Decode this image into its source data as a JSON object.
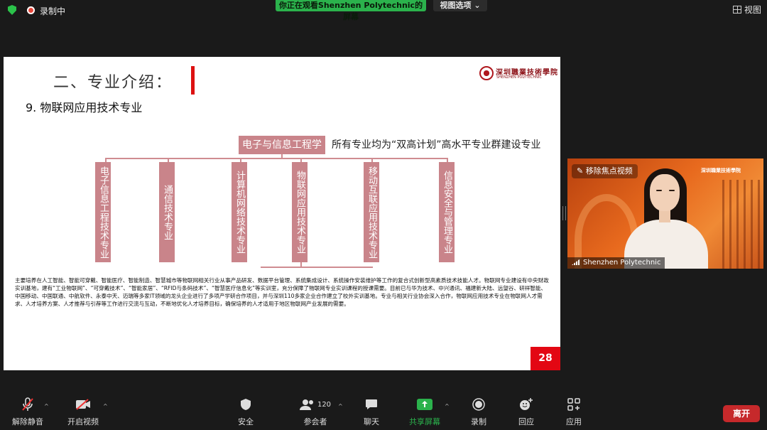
{
  "top": {
    "recording_text": "录制中",
    "share_banner": "你正在观看Shenzhen Polytechnic的屏幕",
    "view_options": "视图选项",
    "view_button": "视图"
  },
  "slide": {
    "title": "二、专业介绍：",
    "logo_cn": "深圳職業技術學院",
    "logo_en": "SHENZHEN POLYTECHNIC",
    "subtitle": "9. 物联网应用技术专业",
    "department": "电子与信息工程学院",
    "note": "所有专业均为“双高计划”高水平专业群建设专业",
    "majors": [
      "电子信息工程技术专业",
      "通信技术专业",
      "计算机网络技术专业",
      "物联网应用技术专业",
      "移动互联应用技术专业",
      "信息安全与管理专业"
    ],
    "body": "主要培养在人工智能、智能可穿戴、智能医疗、智能制造、智慧城市等物联网相关行业从事产品研发、数据平台管理、系统集成设计、系统操作安装维护等工作的复合式创新型高素质技术技能人才。物联网专业建设有中央财政实训基地，建有“工业物联网”、“可穿戴技术”、“智能家居”、“RFID与条码技术”、“智慧医疗信息化”等实训室，充分保障了物联网专业实训课程的授课需要。目前已与华为技术、中兴通讯、福建新大陆、远望谷、研祥智能、中国移动、中国联通、中航软件、永泰中天、迈瑞等多家IT领域的龙头企业进行了多项产学研合作项目，并与深圳110多家企业合作建立了校外实训基地。专业与相关行业协会深入合作，物联网应用技术专业在物联网人才需求、人才培养方案、人才推荐与引荐等工作进行交流与互动，不断地优化人才培养目标，确保培养的人才适用于地区物联网产业发展的需要。",
    "page_number": "28"
  },
  "video": {
    "remove_focus": "移除焦点视频",
    "participant_name": "Shenzhen Polytechnic",
    "bg_logo": "深圳職業技術學院"
  },
  "toolbar": {
    "unmute": "解除静音",
    "start_video": "开启视频",
    "security": "安全",
    "participants": "参会者",
    "participant_count": "120",
    "chat": "聊天",
    "share_screen": "共享屏幕",
    "record": "录制",
    "reactions": "回应",
    "apps": "应用",
    "leave": "离开"
  },
  "colors": {
    "accent_green": "#2bb24c",
    "slide_box": "#c9848a",
    "page_red": "#e30713",
    "leave_red": "#c6292b",
    "video_orange": "#e86a1e"
  }
}
